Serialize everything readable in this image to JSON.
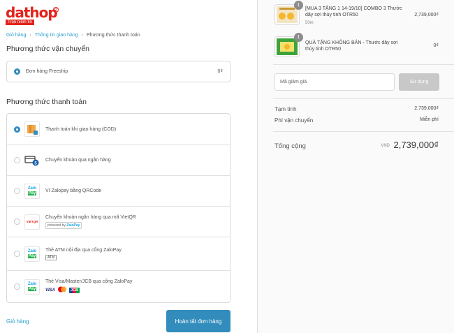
{
  "logo": {
    "brand": "dathop",
    "registered": "R",
    "tagline": "Trọn niềm tin"
  },
  "breadcrumb": {
    "cart": "Giỏ hàng",
    "shipping_info": "Thông tin giao hàng",
    "payment": "Phương thức thanh toán"
  },
  "shipping": {
    "title": "Phương thức vận chuyển",
    "option_label": "Đơn hàng Freeship",
    "option_price": "0₫"
  },
  "payment": {
    "title": "Phương thức thanh toán",
    "methods": [
      {
        "label": "Thanh toán khi giao hàng (COD)",
        "selected": true,
        "icon": "cod-box-icon"
      },
      {
        "label": "Chuyển khoản qua ngân hàng",
        "selected": false,
        "icon": "bank-transfer-icon"
      },
      {
        "label": "Ví Zalopay bằng QRCode",
        "selected": false,
        "icon": "zalopay-icon"
      },
      {
        "label": "Chuyển khoản ngân hàng qua mã VietQR",
        "selected": false,
        "icon": "vietqr-icon",
        "badge": "powered by",
        "badge_brand": "ZaloPay"
      },
      {
        "label": "Thẻ ATM nội địa qua cổng ZaloPay",
        "selected": false,
        "icon": "zalopay-icon",
        "badge": "ATM"
      },
      {
        "label": "Thẻ Visa/Master/JCB qua cổng ZaloPay",
        "selected": false,
        "icon": "zalopay-icon",
        "cards": [
          "VISA",
          "MC",
          "JCB"
        ]
      }
    ],
    "zalo_logo_top": "Zalo",
    "zalo_logo_bottom": "Pay",
    "vietqr_logo": "VIETQR"
  },
  "footer": {
    "back_label": "Giỏ hàng",
    "finish_label": "Hoàn tất đơn hàng"
  },
  "order": {
    "items": [
      {
        "name": "[MUA 3 TẶNG 1 14-19/10] COMBO 3 Thước dây sợi thủy tinh OTR50",
        "variant": "50m",
        "price": "2,739,000₫",
        "qty": "1"
      },
      {
        "name": "QUÀ TẶNG KHÔNG BÁN - Thước dây sợi thủy tinh OTR50",
        "variant": "",
        "price": "0₫",
        "qty": "1"
      }
    ],
    "discount_placeholder": "Mã giảm giá",
    "discount_button": "Sử dụng",
    "subtotal_label": "Tạm tính",
    "subtotal_value": "2,739,000₫",
    "shipping_label": "Phí vận chuyển",
    "shipping_value": "Miễn phí",
    "total_label": "Tổng cộng",
    "currency": "VND",
    "total_value": "2,739,000₫"
  },
  "colors": {
    "brand_red": "#e2231a",
    "accent_blue": "#338dbc",
    "link_blue": "#2a9dcc",
    "zalopay_blue": "#1aa3e8",
    "zalopay_green": "#21b04b"
  }
}
